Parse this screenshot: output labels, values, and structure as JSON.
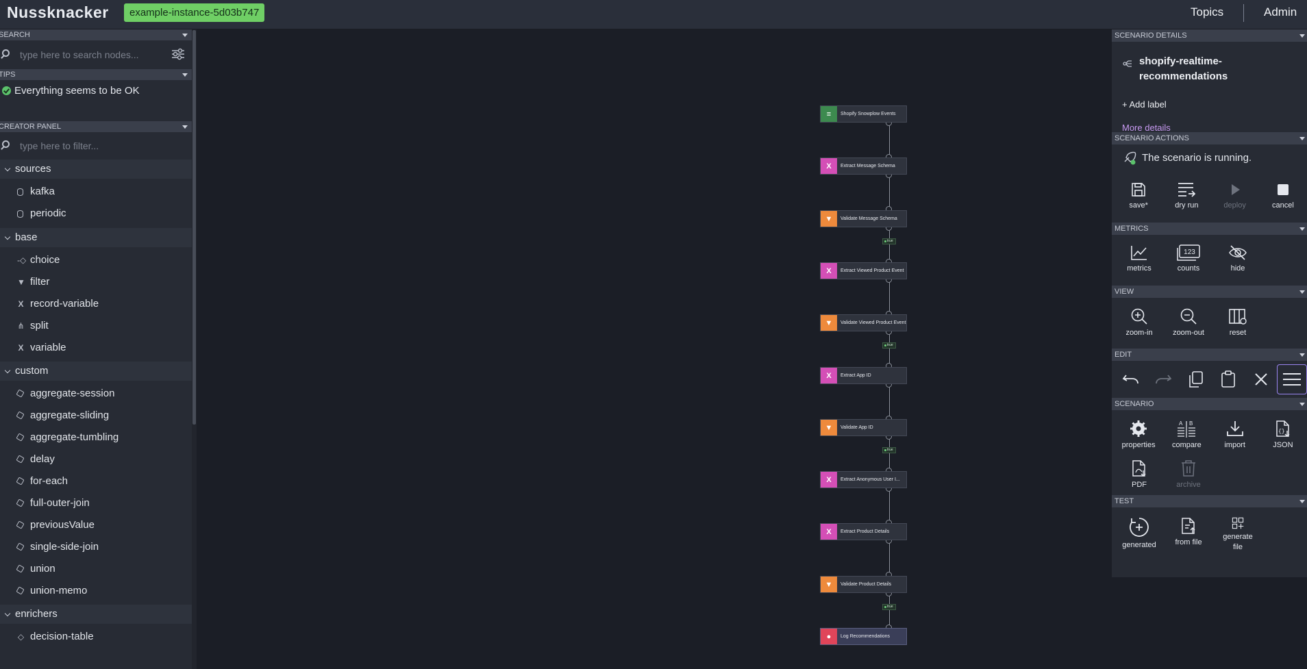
{
  "header": {
    "logo": "Nussknacker",
    "environment": "example-instance-5d03b747",
    "nav": {
      "topics": "Topics",
      "admin": "Admin"
    }
  },
  "left": {
    "search": {
      "title": "SEARCH",
      "placeholder": "type here to search nodes..."
    },
    "tips": {
      "title": "TIPS",
      "message": "Everything seems to be OK"
    },
    "creator": {
      "title": "CREATOR PANEL",
      "placeholder": "type here to filter...",
      "groups": [
        {
          "name": "sources",
          "items": [
            "kafka",
            "periodic"
          ]
        },
        {
          "name": "base",
          "items": [
            "choice",
            "filter",
            "record-variable",
            "split",
            "variable"
          ]
        },
        {
          "name": "custom",
          "items": [
            "aggregate-session",
            "aggregate-sliding",
            "aggregate-tumbling",
            "delay",
            "for-each",
            "full-outer-join",
            "previousValue",
            "single-side-join",
            "union",
            "union-memo"
          ]
        },
        {
          "name": "enrichers",
          "items": [
            "decision-table"
          ]
        }
      ]
    }
  },
  "graph": {
    "nodes": [
      {
        "label": "Shopify Snowplow Events",
        "kind": "source",
        "color": "#3d8a4f"
      },
      {
        "label": "Extract Message Schema",
        "kind": "variable",
        "color": "#d44fb6"
      },
      {
        "label": "Validate Message Schema",
        "kind": "filter",
        "color": "#ee8a3c"
      },
      {
        "label": "Extract Viewed Product Event",
        "kind": "variable",
        "color": "#d44fb6"
      },
      {
        "label": "Validate Viewed Product Event",
        "kind": "filter",
        "color": "#ee8a3c"
      },
      {
        "label": "Extract App ID",
        "kind": "variable",
        "color": "#d44fb6"
      },
      {
        "label": "Validate App ID",
        "kind": "filter",
        "color": "#ee8a3c"
      },
      {
        "label": "Extract Anonymous User I...",
        "kind": "variable",
        "color": "#d44fb6"
      },
      {
        "label": "Extract Product Details",
        "kind": "variable",
        "color": "#d44fb6"
      },
      {
        "label": "Validate Product Details",
        "kind": "filter",
        "color": "#ee8a3c"
      },
      {
        "label": "Log Recommendations",
        "kind": "sink",
        "color": "#e0455a"
      }
    ],
    "true_label": "true"
  },
  "right": {
    "details": {
      "title": "SCENARIO DETAILS",
      "name": "shopify-realtime-recommendations",
      "add_label": "+ Add label",
      "more": "More details"
    },
    "actions": {
      "title": "SCENARIO ACTIONS",
      "status": "The scenario is running.",
      "buttons": [
        "save*",
        "dry run",
        "deploy",
        "cancel"
      ]
    },
    "metrics": {
      "title": "METRICS",
      "buttons": [
        "metrics",
        "counts",
        "hide"
      ]
    },
    "view": {
      "title": "VIEW",
      "buttons": [
        "zoom-in",
        "zoom-out",
        "reset"
      ]
    },
    "edit": {
      "title": "EDIT"
    },
    "scenario": {
      "title": "SCENARIO",
      "buttons": [
        "properties",
        "compare",
        "import",
        "JSON",
        "PDF",
        "archive"
      ]
    },
    "test": {
      "title": "TEST",
      "buttons": [
        "generated",
        "from file",
        "generate file"
      ]
    }
  }
}
